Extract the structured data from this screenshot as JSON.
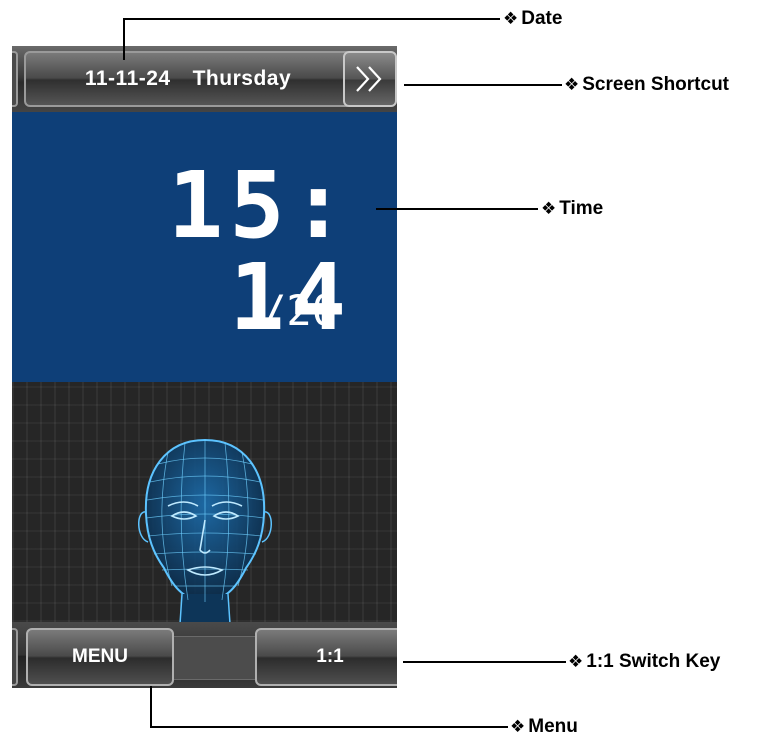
{
  "device": {
    "date": "11-11-24",
    "weekday": "Thursday",
    "time": "15: 14",
    "seconds": "/20",
    "shortcut_glyph": "»",
    "menu_label": "MENU",
    "switch_label": "1:1"
  },
  "callouts": {
    "bullet": "❖",
    "date": "Date",
    "screen_shortcut": "Screen Shortcut",
    "time": "Time",
    "switch_key": "1:1 Switch Key",
    "menu": "Menu"
  },
  "colors": {
    "clock_panel": "#0e3f78",
    "face_wireframe": "#3aa6e6"
  }
}
